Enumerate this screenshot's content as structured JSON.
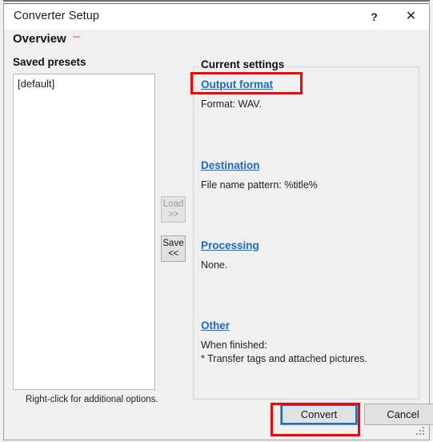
{
  "window": {
    "title": "Converter Setup",
    "help_button": "?",
    "close_button": "✕"
  },
  "header": {
    "title": "Overview"
  },
  "presets": {
    "label": "Saved presets",
    "items": [
      "[default]"
    ],
    "hint": "Right-click for additional options."
  },
  "transfer_buttons": {
    "load": {
      "line1": "Load",
      "line2": ">>",
      "enabled": false
    },
    "save": {
      "line1": "Save",
      "line2": "<<",
      "enabled": true
    }
  },
  "current_settings": {
    "group_label": "Current settings",
    "sections": [
      {
        "link": "Output format",
        "description": "Format: WAV."
      },
      {
        "link": "Destination",
        "description": "File name pattern: %title%"
      },
      {
        "link": "Processing",
        "description": "None."
      },
      {
        "link": "Other",
        "description": "When finished:\n* Transfer tags and attached pictures."
      }
    ]
  },
  "footer": {
    "convert_label": "Convert",
    "cancel_label": "Cancel"
  },
  "colors": {
    "link": "#1b6ac9",
    "annotation": "#ff0000",
    "focus_outline": "#0078d7",
    "window_bg": "#f0f0f0",
    "titlebar_bg": "#ffffff",
    "overview_mark": "#e58fdd"
  }
}
